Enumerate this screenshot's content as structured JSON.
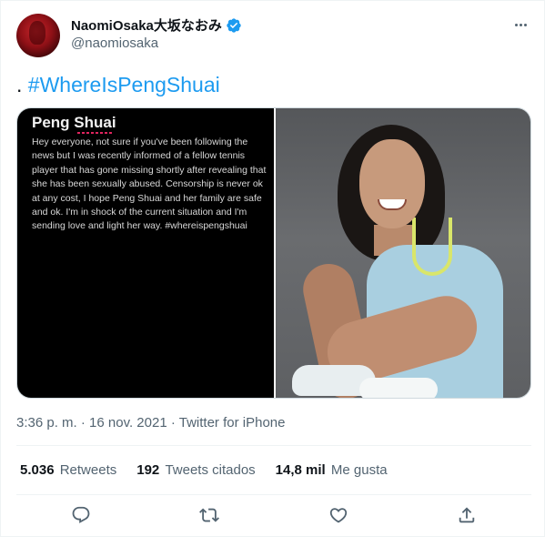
{
  "author": {
    "display_name": "NaomiOsaka大坂なおみ",
    "handle": "@naomiosaka",
    "verified": true,
    "avatar_icon": "avatar-photo"
  },
  "tweet": {
    "prefix": ". ",
    "hashtag": "#WhereIsPengShuai"
  },
  "media": {
    "left": {
      "title": "Peng Shuai",
      "body": "Hey everyone, not sure if you've been following the news but I was recently informed of a fellow tennis player that has gone missing shortly after revealing that she has been sexually abused. Censorship is never ok at any cost, I hope Peng Shuai and her family are safe and ok. I'm in shock of the current situation and I'm sending love and light her way. #whereispengshuai"
    },
    "right": {
      "description_icon": "photo-of-woman-smiling"
    }
  },
  "meta": {
    "time": "3:36 p. m.",
    "dot": " · ",
    "date": "16 nov. 2021",
    "source": "Twitter for iPhone"
  },
  "stats": {
    "retweets_value": "5.036",
    "retweets_label": "Retweets",
    "quotes_value": "192",
    "quotes_label": "Tweets citados",
    "likes_value": "14,8 mil",
    "likes_label": "Me gusta"
  },
  "actions": [
    "reply-icon",
    "retweet-icon",
    "like-icon",
    "share-icon"
  ],
  "colors": {
    "accent": "#1d9bf0",
    "text_primary": "#0f1419",
    "text_secondary": "#536471",
    "border": "#eff3f4"
  }
}
